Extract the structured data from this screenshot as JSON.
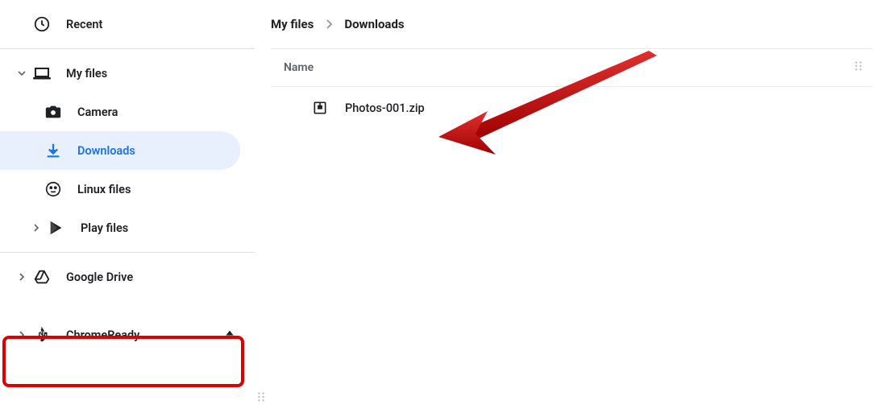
{
  "sidebar": {
    "recent": "Recent",
    "my_files": "My files",
    "camera": "Camera",
    "downloads": "Downloads",
    "linux": "Linux files",
    "play": "Play files",
    "drive": "Google Drive",
    "usb": "ChromeReady"
  },
  "breadcrumb": {
    "root": "My files",
    "current": "Downloads"
  },
  "table": {
    "header_name": "Name",
    "rows": [
      {
        "name": "Photos-001.zip"
      }
    ]
  }
}
